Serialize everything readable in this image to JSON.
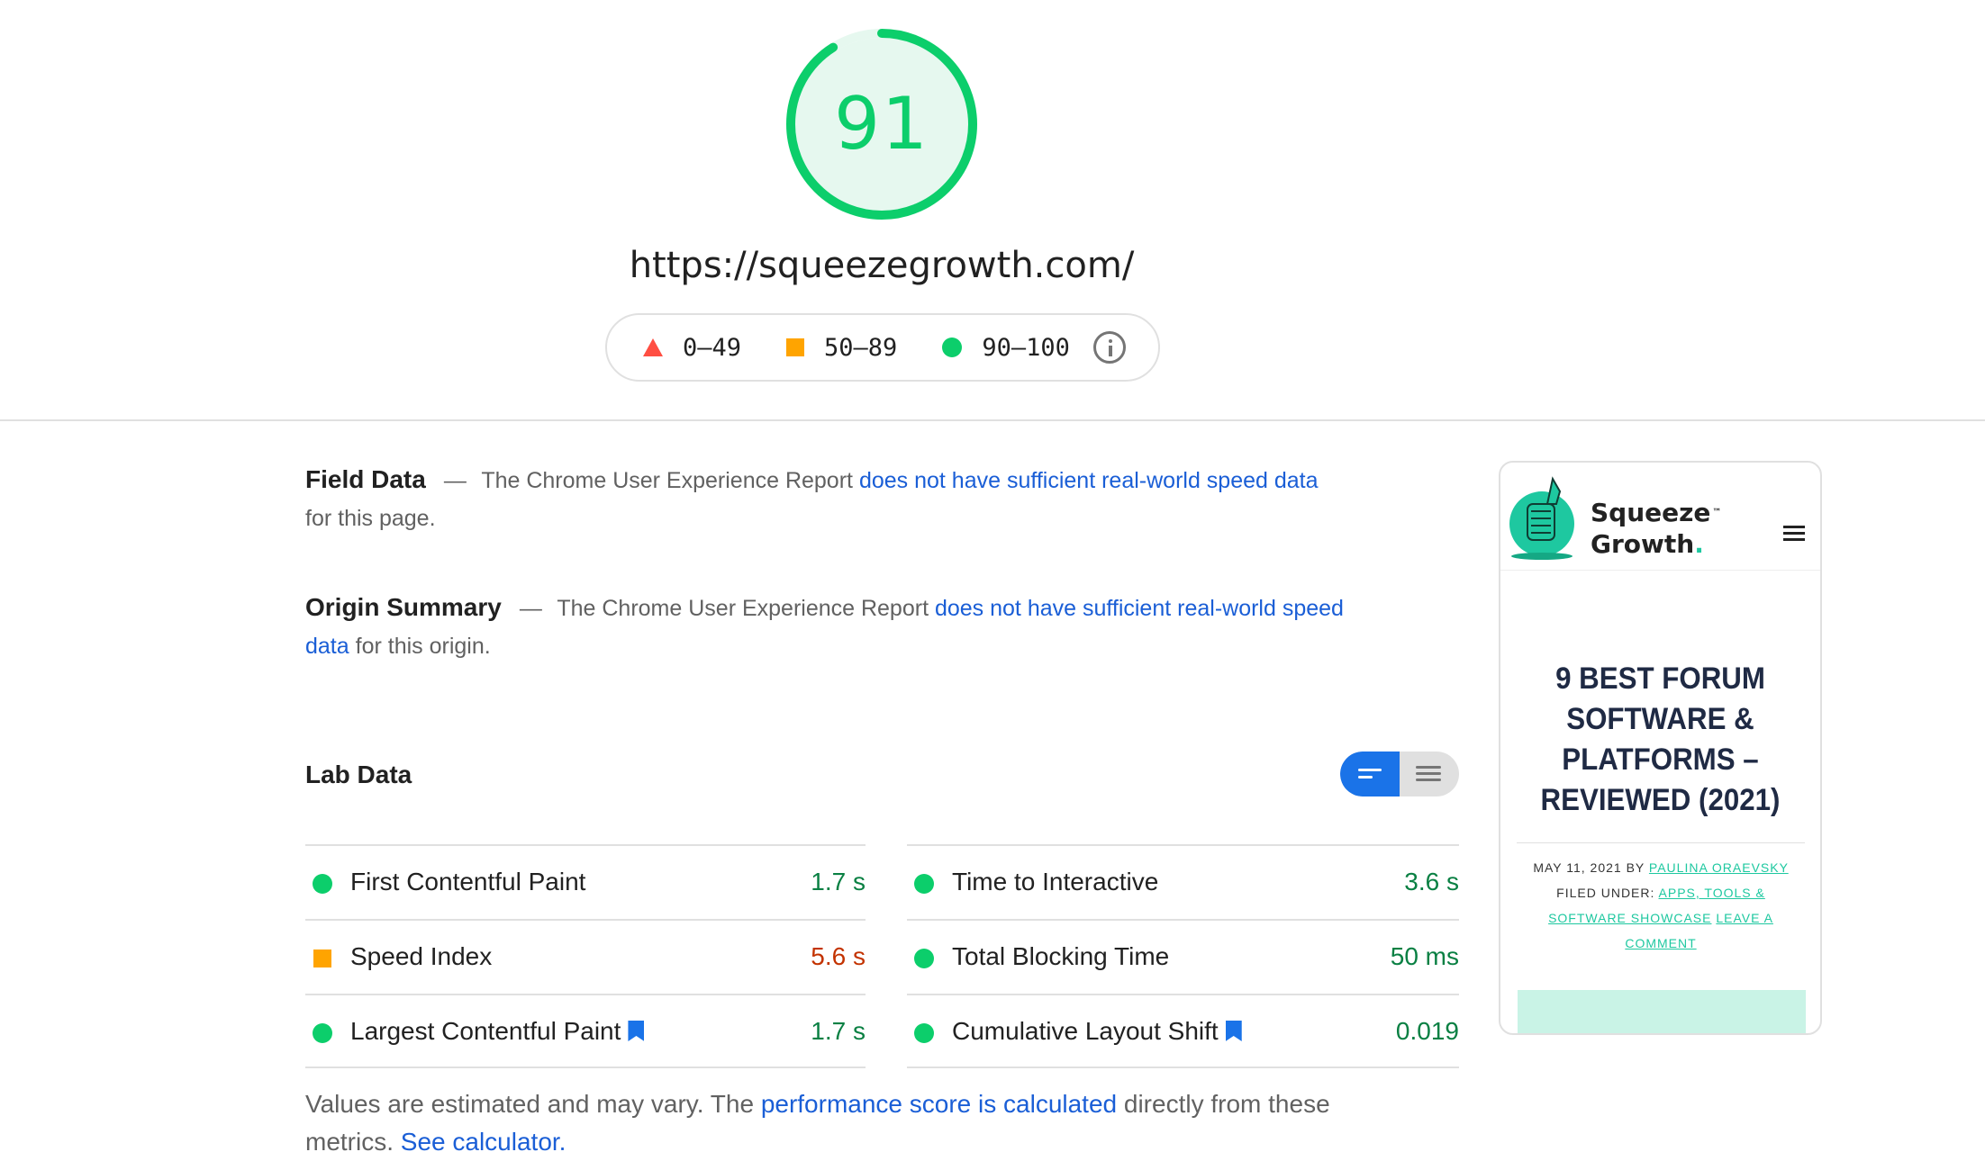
{
  "header": {
    "score": "91",
    "score_fraction": 0.91,
    "url": "https://squeezegrowth.com/",
    "legend": [
      {
        "icon": "triangle-icon",
        "label": "0–49",
        "color": "#ff4e42"
      },
      {
        "icon": "square-icon",
        "label": "50–89",
        "color": "#ffa400"
      },
      {
        "icon": "circle-icon",
        "label": "90–100",
        "color": "#0cce6b"
      }
    ]
  },
  "field_data": {
    "title": "Field Data",
    "dash": "—",
    "text_before": "The Chrome User Experience Report",
    "link": "does not have sufficient real-world speed data",
    "text_after": "for this page."
  },
  "origin_summary": {
    "title": "Origin Summary",
    "dash": "—",
    "text_before": "The Chrome User Experience Report",
    "link": "does not have sufficient real-world speed data",
    "text_after": "for this origin."
  },
  "lab_data": {
    "title": "Lab Data",
    "left_metrics": [
      {
        "label": "First Contentful Paint",
        "value": "1.7 s",
        "status": "pass",
        "bookmark": false
      },
      {
        "label": "Speed Index",
        "value": "5.6 s",
        "status": "average",
        "bookmark": false
      },
      {
        "label": "Largest Contentful Paint",
        "value": "1.7 s",
        "status": "pass",
        "bookmark": true
      }
    ],
    "right_metrics": [
      {
        "label": "Time to Interactive",
        "value": "3.6 s",
        "status": "pass",
        "bookmark": false
      },
      {
        "label": "Total Blocking Time",
        "value": "50 ms",
        "status": "pass",
        "bookmark": false
      },
      {
        "label": "Cumulative Layout Shift",
        "value": "0.019",
        "status": "pass",
        "bookmark": true
      }
    ]
  },
  "footnote": {
    "text_before": "Values are estimated and may vary. The",
    "link1": "performance score is calculated",
    "text_middle": "directly from these metrics.",
    "link2": "See calculator."
  },
  "screenshot": {
    "brand_line1": "Squeeze",
    "brand_tm": "™",
    "brand_line2": "Growth",
    "brand_dot": ".",
    "post_title": "9 BEST FORUM SOFTWARE & PLATFORMS – REVIEWED (2021)",
    "meta_date": "MAY 11, 2021 BY",
    "meta_author": "PAULINA ORAEVSKY",
    "meta_filed": "FILED UNDER:",
    "meta_category": "APPS, TOOLS & SOFTWARE SHOWCASE",
    "meta_comment": "LEAVE A COMMENT"
  }
}
